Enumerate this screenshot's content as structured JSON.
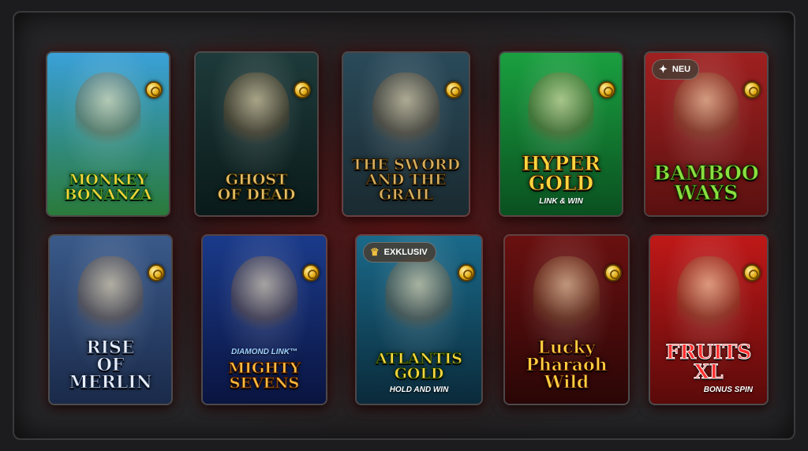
{
  "games": [
    {
      "title": "MONKEY\nBONANZA",
      "colors": [
        "#3aa0d8",
        "#2a7a3a"
      ],
      "title_color": "#ffd23a",
      "stroke": "#1a6a1a"
    },
    {
      "title": "GHOST\nOF DEAD",
      "colors": [
        "#1e3a3a",
        "#0a1a1a"
      ],
      "title_color": "#e8c068",
      "stroke": "#3a2a00"
    },
    {
      "title": "THE SWORD\nAND THE GRAIL",
      "colors": [
        "#2a4a5a",
        "#1a2a30"
      ],
      "title_color": "#d8b060",
      "stroke": "#2a1a00"
    },
    {
      "title": "HYPER\nGOLD",
      "subtitle": "LINK & WIN",
      "colors": [
        "#1aa040",
        "#0a5020"
      ],
      "title_color": "#ffd640",
      "stroke": "#4a2a00"
    },
    {
      "title": "BAMBOO\nWAYS",
      "badge": "NEU",
      "colors": [
        "#a02020",
        "#5a1010"
      ],
      "title_color": "#8ae040",
      "stroke": "#1a3a00"
    },
    {
      "title": "RISE\nOF\nMERLIN",
      "colors": [
        "#3a5a8a",
        "#1a2a4a"
      ],
      "title_color": "#e8eef8",
      "stroke": "#1a2a4a"
    },
    {
      "title": "MIGHTY\nSEVENS",
      "subtitle": "DIAMOND LINK™",
      "colors": [
        "#1a3a8a",
        "#0a1440"
      ],
      "title_color": "#ffc040",
      "stroke": "#4a1a00"
    },
    {
      "title": "ATLANTIS\nGOLD",
      "subtitle": "HOLD AND WIN",
      "badge": "EXKLUSIV",
      "colors": [
        "#1a6a8a",
        "#0a2a3a"
      ],
      "title_color": "#ffd640",
      "stroke": "#1a3a00"
    },
    {
      "title": "Lucky\nPharaoh\nWild",
      "colors": [
        "#6a1010",
        "#2a0606"
      ],
      "title_color": "#ffd040",
      "stroke": "#3a0a00"
    },
    {
      "title": "FRUITS\nXL",
      "subtitle": "BONUS SPIN",
      "colors": [
        "#c01818",
        "#5a0a0a"
      ],
      "title_color": "#ff3030",
      "stroke": "#ffffff"
    }
  ],
  "badge_icons": {
    "NEU": "✦",
    "EXKLUSIV": "♛"
  }
}
